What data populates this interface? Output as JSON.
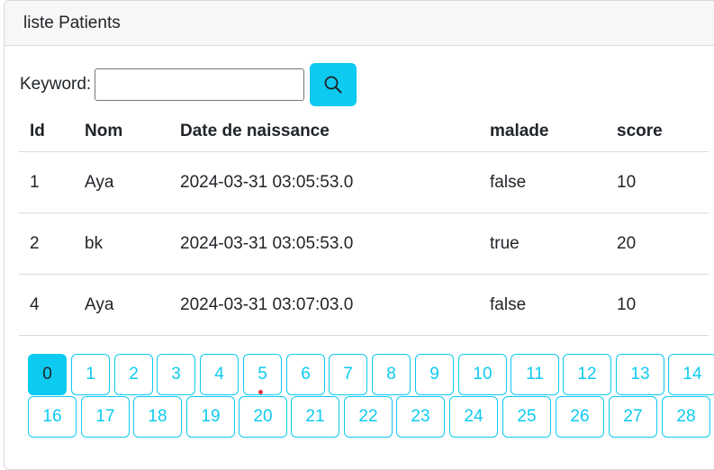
{
  "card": {
    "title": "liste Patients"
  },
  "search": {
    "label": "Keyword:",
    "value": "",
    "placeholder": ""
  },
  "table": {
    "headers": [
      "Id",
      "Nom",
      "Date de naissance",
      "malade",
      "score"
    ],
    "rows": [
      [
        "1",
        "Aya",
        "2024-03-31 03:05:53.0",
        "false",
        "10"
      ],
      [
        "2",
        "bk",
        "2024-03-31 03:05:53.0",
        "true",
        "20"
      ],
      [
        "4",
        "Aya",
        "2024-03-31 03:07:03.0",
        "false",
        "10"
      ]
    ]
  },
  "pagination": {
    "current": "0",
    "pages": [
      "0",
      "1",
      "2",
      "3",
      "4",
      "5",
      "6",
      "7",
      "8",
      "9",
      "10",
      "11",
      "12",
      "13",
      "14",
      "16",
      "17",
      "18",
      "19",
      "20",
      "21",
      "22",
      "23",
      "24",
      "25",
      "26",
      "27",
      "28"
    ]
  },
  "colors": {
    "accent": "#0dcaf0",
    "header_bg": "#f7f7f7",
    "border": "#d9dcdf"
  },
  "icons": {
    "search_button": "search-icon"
  }
}
